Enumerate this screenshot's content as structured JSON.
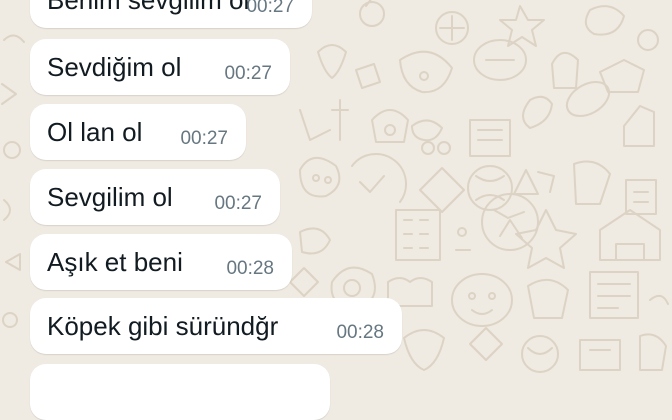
{
  "chat": {
    "messages": [
      {
        "text": "Benim sevgilim ol",
        "time": "00:27"
      },
      {
        "text": "Sevdiğim ol",
        "time": "00:27"
      },
      {
        "text": "Ol lan ol",
        "time": "00:27"
      },
      {
        "text": "Sevgilim ol",
        "time": "00:27"
      },
      {
        "text": "Aşık et beni",
        "time": "00:28"
      },
      {
        "text": "Köpek gibi süründğr",
        "time": "00:28"
      },
      {
        "text": "",
        "time": ""
      }
    ]
  },
  "colors": {
    "wallpaper": "#efeae2",
    "wallpaper_doodle": "#dcd3c4",
    "bubble": "#ffffff",
    "message_text": "#111b21",
    "timestamp": "#667781"
  },
  "icons": [
    "doodle-wallpaper-pattern"
  ]
}
